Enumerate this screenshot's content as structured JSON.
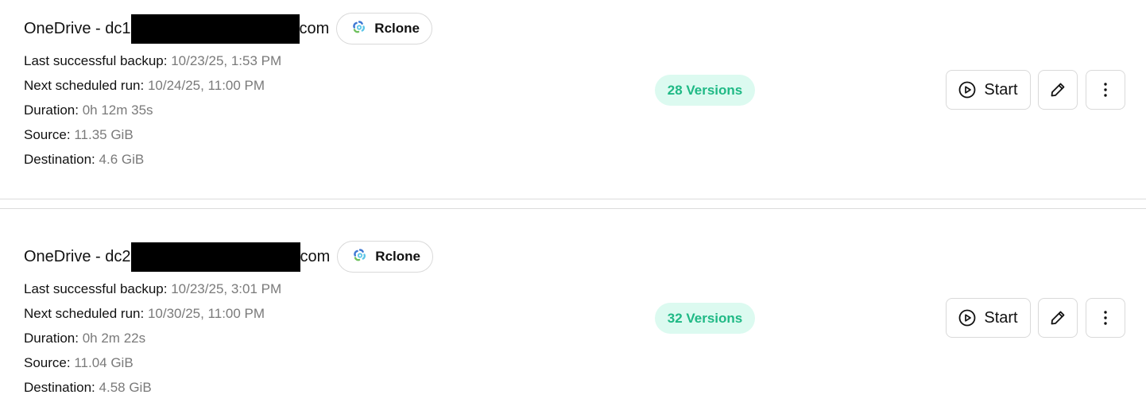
{
  "accent_color": "#1fb985",
  "badge_bg_color": "#dcfaf0",
  "backups": [
    {
      "name_prefix": "OneDrive - dc1",
      "name_suffix": "com",
      "provider": "Rclone",
      "provider_icon": "rclone-icon",
      "details": [
        {
          "label": "Last successful backup:",
          "value": "10/23/25, 1:53 PM"
        },
        {
          "label": "Next scheduled run:",
          "value": "10/24/25, 11:00 PM"
        },
        {
          "label": "Duration:",
          "value": "0h 12m 35s"
        },
        {
          "label": "Source:",
          "value": "11.35 GiB"
        },
        {
          "label": "Destination:",
          "value": "4.6 GiB"
        }
      ],
      "versions": "28 Versions",
      "start_label": "Start"
    },
    {
      "name_prefix": "OneDrive - dc2",
      "name_suffix": "com",
      "provider": "Rclone",
      "provider_icon": "rclone-icon",
      "details": [
        {
          "label": "Last successful backup:",
          "value": "10/23/25, 3:01 PM"
        },
        {
          "label": "Next scheduled run:",
          "value": "10/30/25, 11:00 PM"
        },
        {
          "label": "Duration:",
          "value": "0h 2m 22s"
        },
        {
          "label": "Source:",
          "value": "11.04 GiB"
        },
        {
          "label": "Destination:",
          "value": "4.58 GiB"
        }
      ],
      "versions": "32 Versions",
      "start_label": "Start"
    }
  ]
}
